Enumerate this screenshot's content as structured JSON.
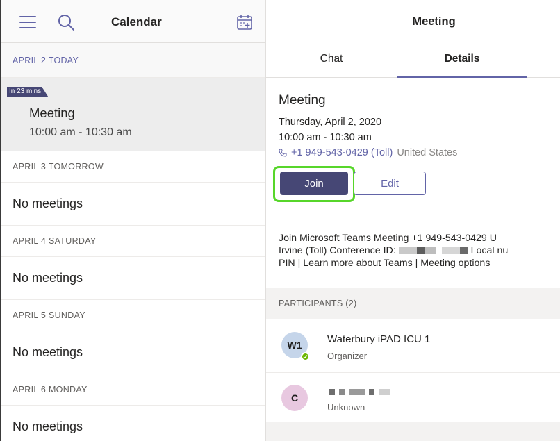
{
  "calendar": {
    "title": "Calendar",
    "days": [
      {
        "header": "APRIL 2  TODAY",
        "meeting": {
          "badge": "In 23 mins",
          "title": "Meeting",
          "time": "10:00 am - 10:30 am"
        }
      },
      {
        "header": "APRIL 3  TOMORROW",
        "empty_label": "No meetings"
      },
      {
        "header": "APRIL 4  SATURDAY",
        "empty_label": "No meetings"
      },
      {
        "header": "APRIL 5  SUNDAY",
        "empty_label": "No meetings"
      },
      {
        "header": "APRIL 6  MONDAY",
        "empty_label": "No meetings"
      }
    ]
  },
  "meeting": {
    "header_title": "Meeting",
    "tabs": [
      {
        "label": "Chat",
        "active": false
      },
      {
        "label": "Details",
        "active": true
      }
    ],
    "details": {
      "title": "Meeting",
      "date": "Thursday, April 2, 2020",
      "time": "10:00 am - 10:30 am",
      "phone": "+1 949-543-0429 (Toll)",
      "phone_country": "United States",
      "join_label": "Join",
      "edit_label": "Edit",
      "description_line1": "Join Microsoft Teams Meeting +1 949-543-0429 U",
      "description_line2_a": "Irvine (Toll)  Conference ID:",
      "description_line2_b": "Local nu",
      "description_line3": "PIN | Learn more about Teams | Meeting options"
    },
    "participants": {
      "header": "PARTICIPANTS (2)",
      "items": [
        {
          "initials": "W1",
          "name": "Waterbury iPAD ICU 1",
          "role": "Organizer"
        },
        {
          "initials": "C",
          "name": "",
          "role": "Unknown"
        }
      ]
    }
  },
  "colors": {
    "accent": "#6264a7",
    "join_button": "#464775",
    "highlight": "#57d62a",
    "presence_available": "#6bb700"
  },
  "icons": [
    "hamburger-menu-icon",
    "search-icon",
    "calendar-add-icon",
    "phone-icon",
    "checkmark-icon"
  ]
}
